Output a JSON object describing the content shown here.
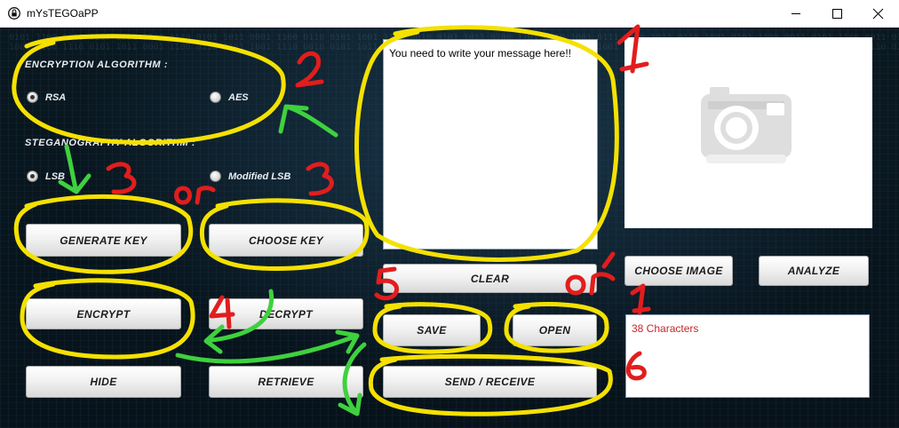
{
  "window": {
    "title": "mYsTEGOaPP",
    "controls": [
      "minimize",
      "maximize",
      "close"
    ]
  },
  "encryption": {
    "label": "ENCRYPTION ALGORITHM :",
    "options": [
      {
        "label": "RSA",
        "selected": true
      },
      {
        "label": "AES",
        "selected": false
      }
    ]
  },
  "steganography": {
    "label": "STEGANOGRAPHY ALGORITHM :",
    "options": [
      {
        "label": "LSB",
        "selected": true
      },
      {
        "label": "Modified LSB",
        "selected": false
      }
    ]
  },
  "buttons": {
    "generate_key": "GENERATE KEY",
    "choose_key": "CHOOSE KEY",
    "encrypt": "ENCRYPT",
    "decrypt": "DECRYPT",
    "hide": "HIDE",
    "retrieve": "RETRIEVE",
    "clear": "CLEAR",
    "save": "SAVE",
    "open": "OPEN",
    "send_receive": "SEND / RECEIVE",
    "choose_image": "CHOOSE IMAGE",
    "analyze": "ANALYZE"
  },
  "message": {
    "value": "You need to write your message here!!"
  },
  "image_panel": {
    "icon": "camera-icon"
  },
  "status": {
    "character_count": "38 Characters"
  },
  "annotations": {
    "numbers": [
      "1",
      "2",
      "3",
      "3",
      "4",
      "5",
      "6",
      "1"
    ],
    "or_labels": [
      "or",
      "or"
    ],
    "highlight_color": "#f5e100",
    "number_color": "#e21d1d",
    "arrow_color": "#3ed13e"
  }
}
